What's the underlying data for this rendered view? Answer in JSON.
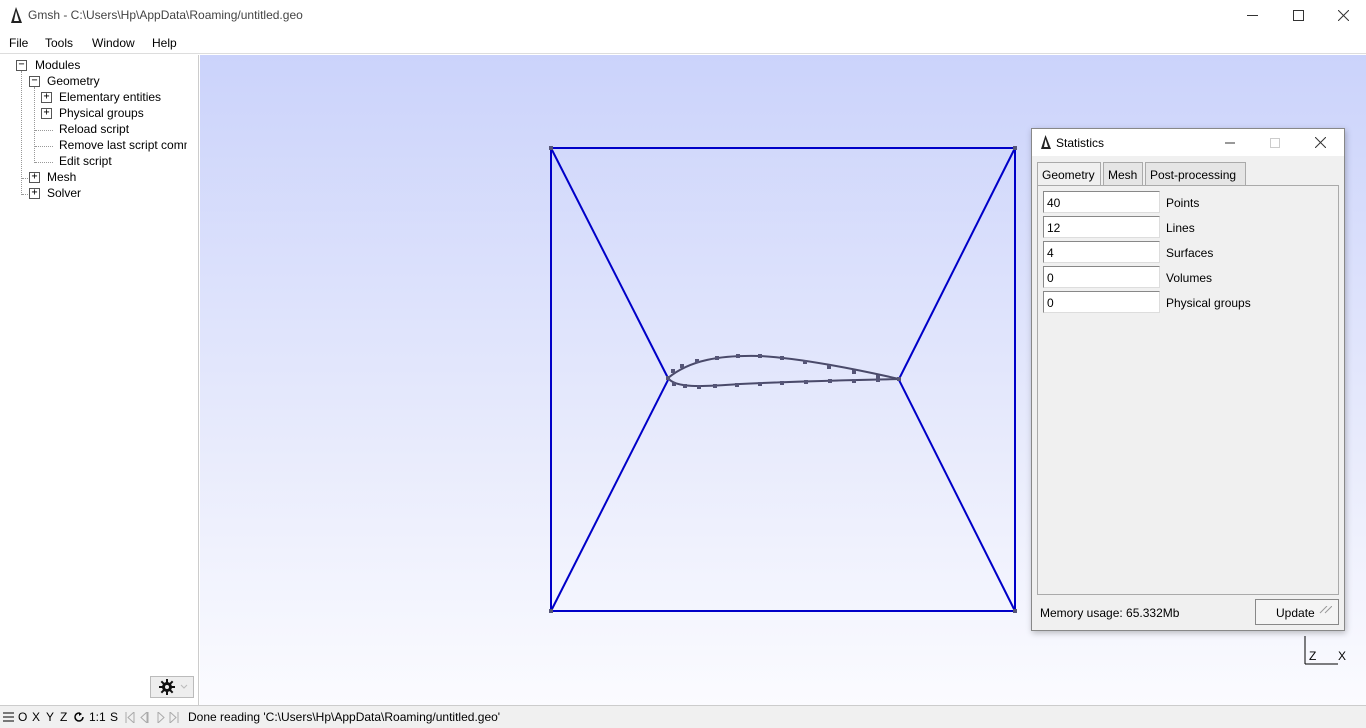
{
  "window": {
    "title": "Gmsh - C:\\Users\\Hp\\AppData\\Roaming/untitled.geo",
    "minimize": "—",
    "maximize": "☐",
    "close": "✕"
  },
  "menu": {
    "file": "File",
    "tools": "Tools",
    "window": "Window",
    "help": "Help"
  },
  "tree": {
    "modules": "Modules",
    "geometry": "Geometry",
    "elementary": "Elementary entities",
    "physical": "Physical groups",
    "reload": "Reload script",
    "remove_last": "Remove last script command",
    "edit": "Edit script",
    "mesh": "Mesh",
    "solver": "Solver",
    "expanded_symbol": "−",
    "collapsed_symbol": "+"
  },
  "statusbar": {
    "message": "Done reading 'C:\\Users\\Hp\\AppData\\Roaming/untitled.geo'",
    "o": "O",
    "x": "X",
    "y": "Y",
    "z": "Z",
    "scale": "1:1",
    "s": "S"
  },
  "stats": {
    "title": "Statistics",
    "tabs": [
      "Geometry",
      "Mesh",
      "Post-processing"
    ],
    "rows": [
      {
        "value": "40",
        "label": "Points"
      },
      {
        "value": "12",
        "label": "Lines"
      },
      {
        "value": "4",
        "label": "Surfaces"
      },
      {
        "value": "0",
        "label": "Volumes"
      },
      {
        "value": "0",
        "label": "Physical groups"
      }
    ],
    "memory": "Memory usage: 65.332Mb",
    "update": "Update"
  },
  "axes": {
    "z": "Z",
    "x": "X"
  },
  "colors": {
    "geometry_line": "#0000c8",
    "airfoil_line": "#4a4a6a",
    "point": "#555577"
  }
}
